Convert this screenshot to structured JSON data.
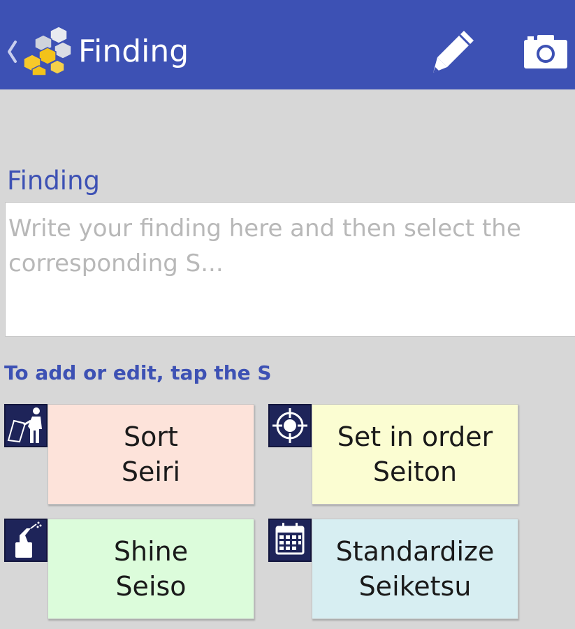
{
  "appbar": {
    "title": "Finding",
    "background": "#3d51b4",
    "back_icon": "chevron-left-icon",
    "logo_icon": "honeycomb-logo-icon",
    "actions": [
      {
        "icon": "pencil-icon"
      },
      {
        "icon": "camera-icon"
      }
    ]
  },
  "finding": {
    "label": "Finding",
    "value": "",
    "placeholder": "Write your finding here and then select the corresponding S..."
  },
  "hint": "To add or edit, tap the S",
  "s_items": [
    {
      "english": "Sort",
      "japanese": "Seiri",
      "color": "#fde3da",
      "icon": "sort-worker-icon"
    },
    {
      "english": "Set in order",
      "japanese": "Seiton",
      "color": "#fbfdd2",
      "icon": "target-icon"
    },
    {
      "english": "Shine",
      "japanese": "Seiso",
      "color": "#dcfcdb",
      "icon": "cleaning-spray-icon"
    },
    {
      "english": "Standardize",
      "japanese": "Seiketsu",
      "color": "#d7eef2",
      "icon": "calendar-icon"
    }
  ]
}
